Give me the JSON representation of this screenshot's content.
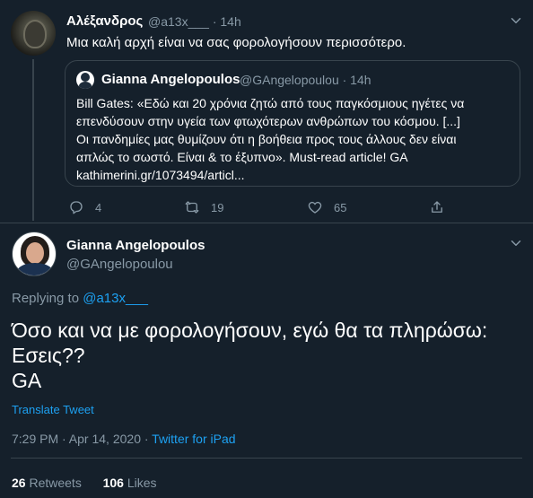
{
  "top_tweet": {
    "name": "Αλέξανδρος",
    "handle": "@a13x___",
    "time": "· 14h",
    "text": "Μια καλή αρχή είναι να σας φορολογήσουν περισσότερο."
  },
  "quoted_tweet": {
    "name": "Gianna Angelopoulos",
    "handle": "@GAngelopoulou · 14h",
    "text_line1": "Bill Gates: «Εδώ και 20 χρόνια ζητώ από τους παγκόσμιους ηγέτες να",
    "text_line2": "επενδύσουν στην υγεία των φτωχότερων ανθρώπων του κόσμου. [...]",
    "text_line3": "Οι πανδημίες μας θυμίζουν ότι η βοήθεια προς τους άλλους δεν είναι",
    "text_line4": "απλώς το σωστό. Είναι & το έξυπνο». Must-read article! GA",
    "text_line5": "kathimerini.gr/1073494/articl..."
  },
  "actions": {
    "replies": "4",
    "retweets": "19",
    "likes": "65"
  },
  "main_tweet": {
    "name": "Gianna Angelopoulos",
    "handle": "@GAngelopoulou",
    "replying_prefix": "Replying to ",
    "replying_to": "@a13x___",
    "text_line1": "Όσο και να με φορολογήσουν, εγώ θα τα πληρώσω:",
    "text_line2": "Εσεις??",
    "text_line3": "GA",
    "translate": "Translate Tweet",
    "timestamp": "7:29 PM · Apr 14, 2020 · ",
    "source": "Twitter for iPad",
    "retweets_count": "26",
    "retweets_label": " Retweets",
    "likes_count": "106",
    "likes_label": " Likes"
  },
  "icons": {
    "top_menu": "chevron-down-icon",
    "reply": "reply-icon",
    "retweet": "retweet-icon",
    "like": "heart-icon",
    "share": "share-icon"
  },
  "colors": {
    "background": "#15202b",
    "accent": "#1da1f2",
    "muted": "#8899a6",
    "border": "#38444d"
  }
}
